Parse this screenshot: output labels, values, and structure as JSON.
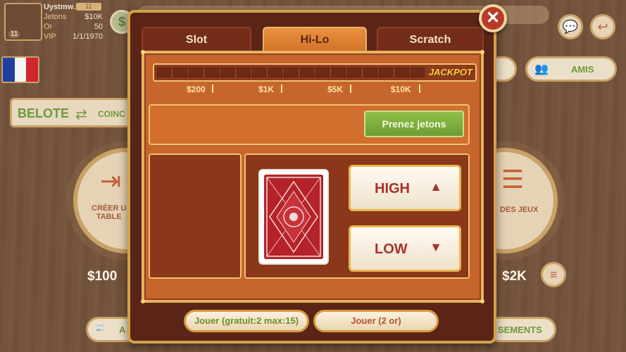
{
  "profile": {
    "name": "Uystmw...",
    "messages": "11",
    "level": "11",
    "rows": [
      {
        "key": "Jetons",
        "value": "$10K"
      },
      {
        "key": "Or",
        "value": "50"
      },
      {
        "key": "VIP",
        "value": "1/1/1970"
      }
    ]
  },
  "lobby": {
    "belote": "BELOTE",
    "coinche": "COINC",
    "create_table": "CRÉER U\nTABLE",
    "games_list": "DES JEUX",
    "left_amount": "$100",
    "right_amount": "$2K",
    "amis": "AMIS",
    "news_left": "A",
    "news_right": "SEMENTS"
  },
  "modal": {
    "tabs": [
      "Slot",
      "Hi-Lo",
      "Scratch"
    ],
    "active_tab": "Hi-Lo",
    "jackpot_label": "JACKPOT",
    "jackpot_segments": 17,
    "ticks": [
      "$200",
      "$1K",
      "$5K",
      "$10K"
    ],
    "take_chips": "Prenez jetons",
    "high": "HIGH",
    "low": "LOW",
    "play_free": "Jouer (gratuit:2 max:15)",
    "play_gold": "Jouer (2 or)",
    "close": "✕"
  },
  "colors": {
    "accent_gold": "#d4a14a",
    "green": "#7aa83a",
    "red": "#b73b26"
  }
}
